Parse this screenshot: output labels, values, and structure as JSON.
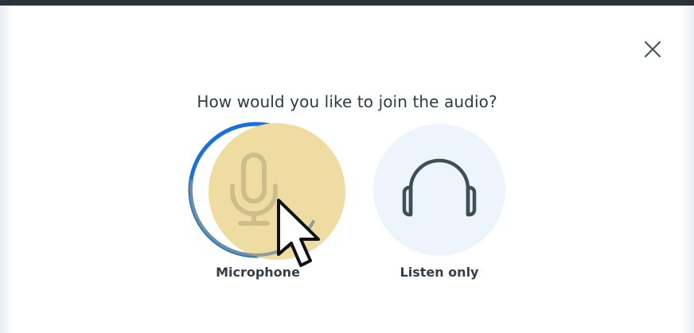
{
  "dialog": {
    "title": "How would you like to join the audio?",
    "close_icon": "close-icon"
  },
  "options": [
    {
      "label": "Microphone",
      "icon": "microphone-icon",
      "state": "focused-hover"
    },
    {
      "label": "Listen only",
      "icon": "headphones-icon",
      "state": "default"
    }
  ],
  "colors": {
    "focus_ring": "#1b71d8",
    "mic_hover_fill": "#eedca2",
    "listen_fill": "#eef4fb",
    "icon_stroke": "#3e4f5b",
    "text": "#2e3a44"
  }
}
